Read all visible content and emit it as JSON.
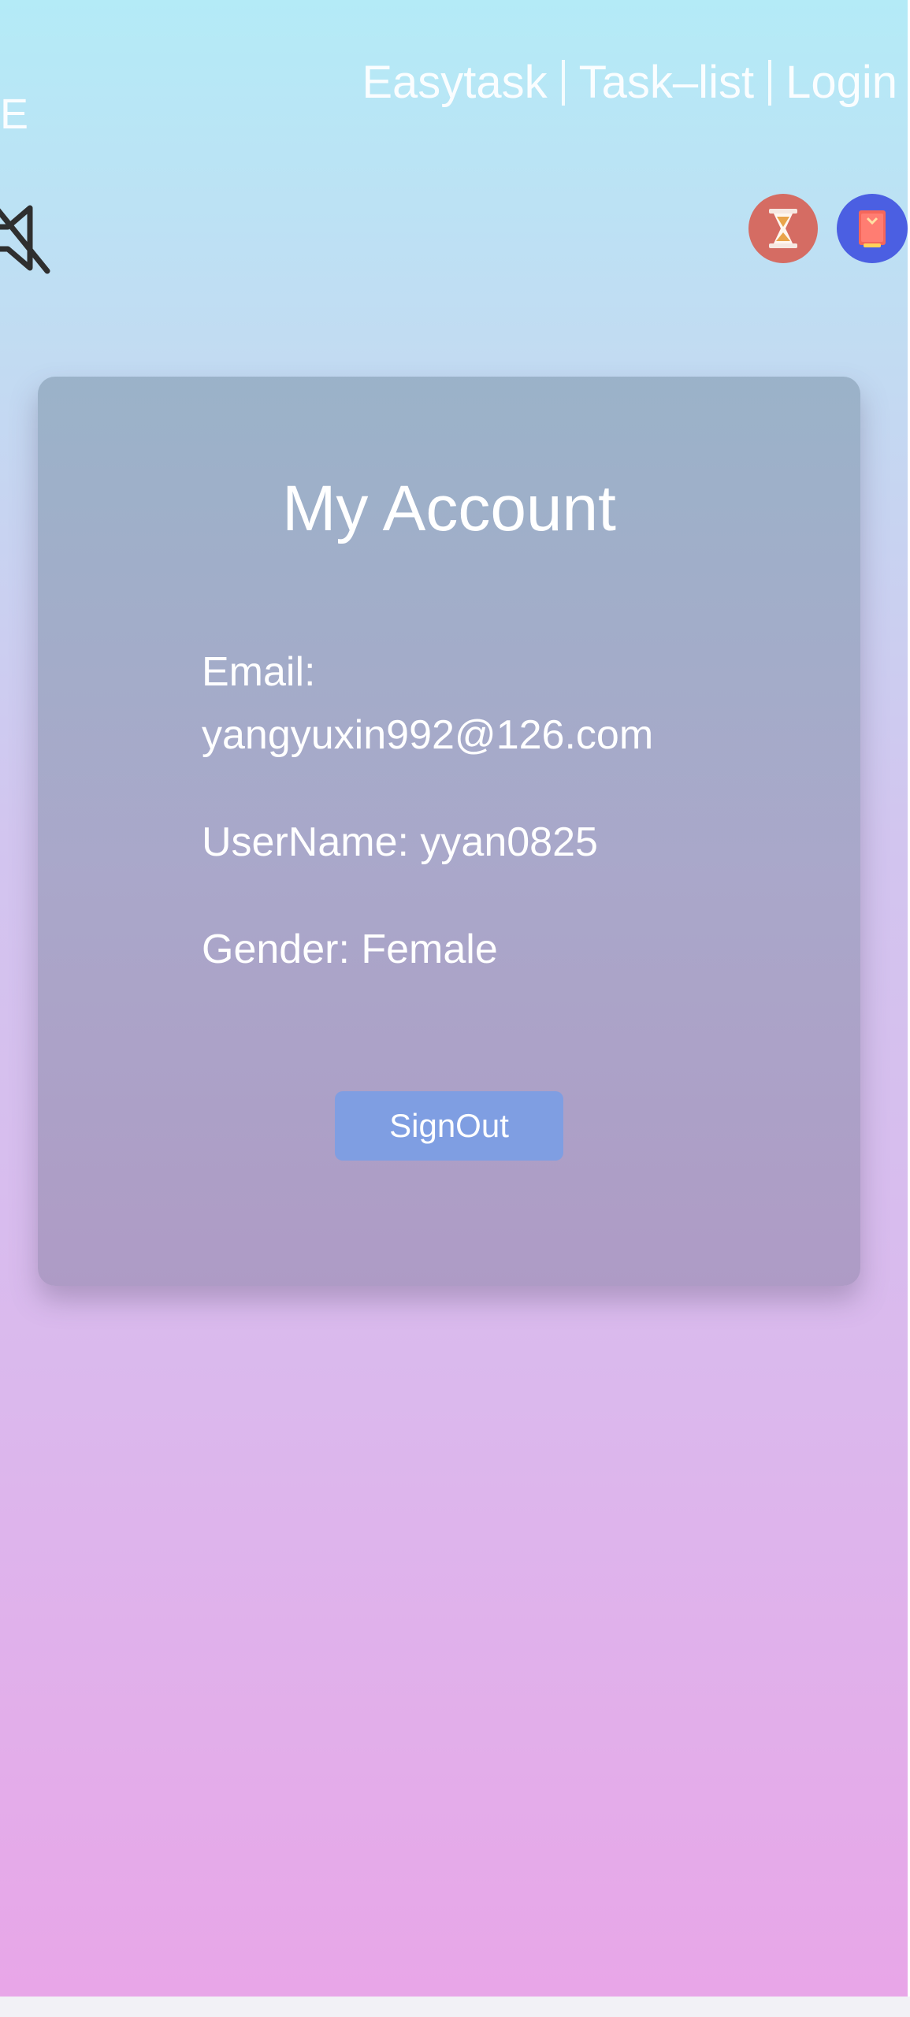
{
  "header": {
    "brand_fragment": "E",
    "nav": [
      {
        "label": "Easytask"
      },
      {
        "label": "Task–list"
      },
      {
        "label": "Login"
      }
    ]
  },
  "toolbar": {
    "mute_icon": "volume-muted-icon",
    "timer_icon": "hourglass-icon",
    "book_icon": "book-icon"
  },
  "account": {
    "title": "My Account",
    "email_label": "Email:",
    "email_value": "yangyuxin992@126.com",
    "username_label": "UserName:",
    "username_value": "yyan0825",
    "gender_label": "Gender:",
    "gender_value": "Female",
    "signout_label": "SignOut"
  },
  "colors": {
    "background_top": "#b4ebf7",
    "background_bottom": "#e8a6e8",
    "card": "#a8a6c8",
    "signout_button": "#7f9ee2",
    "timer_badge": "#d56c63",
    "book_badge": "#4b5fe2"
  }
}
